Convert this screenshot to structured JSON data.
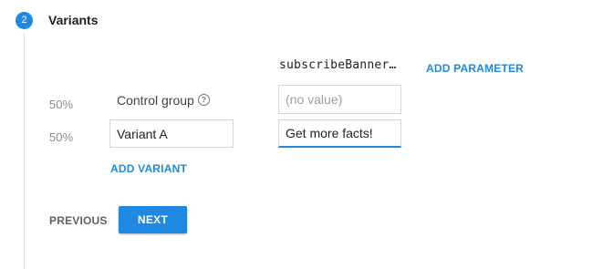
{
  "step": {
    "number": "2",
    "title": "Variants"
  },
  "parameter": {
    "name": "subscribeBanner…",
    "add_label": "ADD PARAMETER"
  },
  "rows": [
    {
      "percent": "50%",
      "name": "Control group",
      "value": "",
      "value_placeholder": "(no value)"
    },
    {
      "percent": "50%",
      "name": "Variant A",
      "value": "Get more facts!"
    }
  ],
  "add_variant_label": "ADD VARIANT",
  "nav": {
    "previous_label": "PREVIOUS",
    "next_label": "NEXT"
  },
  "colors": {
    "accent": "#1e88e5"
  },
  "icons": {
    "help": "help-circle-icon"
  }
}
